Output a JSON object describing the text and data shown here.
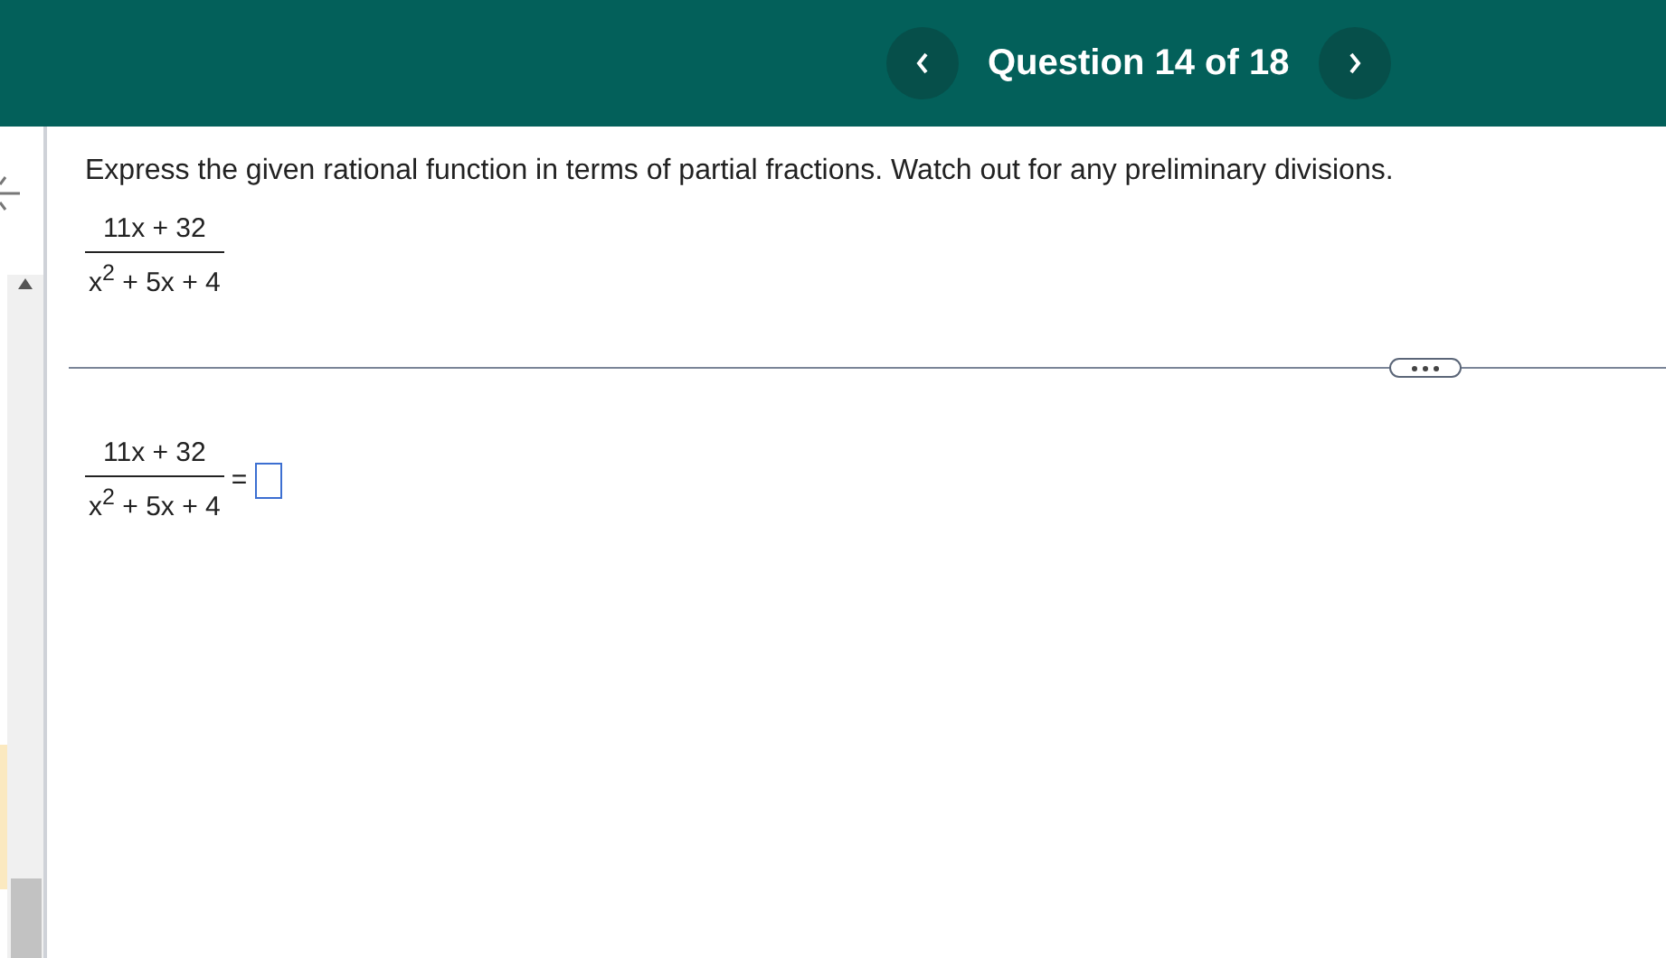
{
  "header": {
    "title": "Question 14 of 18"
  },
  "question": {
    "text": "Express the given rational function in terms of partial fractions. Watch out for any preliminary divisions.",
    "numerator": "11x + 32",
    "denominator": "x$^{2}$ + 5x + 4"
  },
  "answer": {
    "numerator": "11x + 32",
    "denominator": "x$^{2}$ + 5x + 4",
    "equals": "="
  }
}
